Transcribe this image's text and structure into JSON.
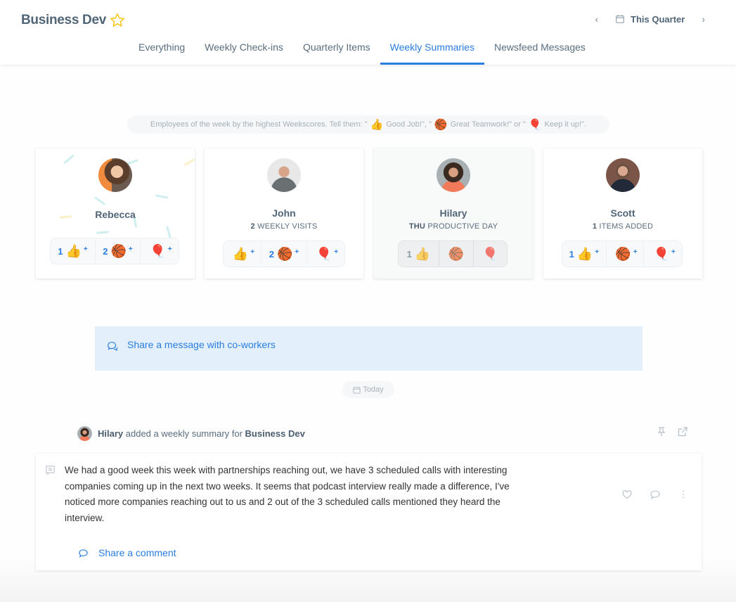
{
  "header": {
    "title": "Business Dev",
    "period": {
      "label": "This Quarter",
      "prev_icon": "chevron-left-icon",
      "next_icon": "chevron-right-icon"
    },
    "tabs": [
      {
        "label": "Everything",
        "active": false
      },
      {
        "label": "Weekly Check-ins",
        "active": false
      },
      {
        "label": "Quarterly Items",
        "active": false
      },
      {
        "label": "Weekly Summaries",
        "active": true
      },
      {
        "label": "Newsfeed Messages",
        "active": false
      }
    ]
  },
  "hint": {
    "prefix": "Employees of the week by the highest Weekscores. Tell them: \"",
    "good_job": "Good Job!\", \"",
    "teamwork": "Great Teamwork!\" or \"",
    "keep_up": "Keep it up!\".",
    "emoji": {
      "thumbs": "👍",
      "ball": "🏀",
      "balloon": "🎈"
    }
  },
  "employees": [
    {
      "name": "Rebecca",
      "stat_value": "",
      "stat_label": "",
      "reactions": [
        {
          "count": "1",
          "emoji": "👍",
          "plus": "+"
        },
        {
          "count": "2",
          "emoji": "🏀",
          "plus": "+"
        },
        {
          "count": "",
          "emoji": "🎈",
          "plus": "+"
        }
      ]
    },
    {
      "name": "John",
      "stat_value": "2",
      "stat_label": "WEEKLY VISITS",
      "reactions": [
        {
          "count": "",
          "emoji": "👍",
          "plus": "+"
        },
        {
          "count": "2",
          "emoji": "🏀",
          "plus": "+"
        },
        {
          "count": "",
          "emoji": "🎈",
          "plus": "+"
        }
      ]
    },
    {
      "name": "Hilary",
      "stat_value": "THU",
      "stat_label": "PRODUCTIVE DAY",
      "reactions": [
        {
          "count": "1",
          "emoji": "👍",
          "plus": ""
        },
        {
          "count": "",
          "emoji": "🏀",
          "plus": ""
        },
        {
          "count": "",
          "emoji": "🎈",
          "plus": ""
        }
      ]
    },
    {
      "name": "Scott",
      "stat_value": "1",
      "stat_label": "ITEMS ADDED",
      "reactions": [
        {
          "count": "1",
          "emoji": "👍",
          "plus": "+"
        },
        {
          "count": "",
          "emoji": "🏀",
          "plus": "+"
        },
        {
          "count": "",
          "emoji": "🎈",
          "plus": "+"
        }
      ]
    }
  ],
  "share_message": "Share a message with co-workers",
  "date_divider": "Today",
  "feed": {
    "author": "Hilary",
    "action": " added a weekly summary for ",
    "target": "Business Dev",
    "body": "We had a good week this week with partnerships reaching out, we have 3 scheduled calls with interesting companies coming up in the next two weeks. It seems that podcast interview really made a difference, I've noticed more companies reaching out to us and 2 out of the 3 scheduled calls mentioned they heard the interview.",
    "comment_label": "Share a comment"
  },
  "colors": {
    "accent": "#2a7de1",
    "title": "#506577",
    "share_bg": "#e3f0fc",
    "star": "#f5c518"
  }
}
